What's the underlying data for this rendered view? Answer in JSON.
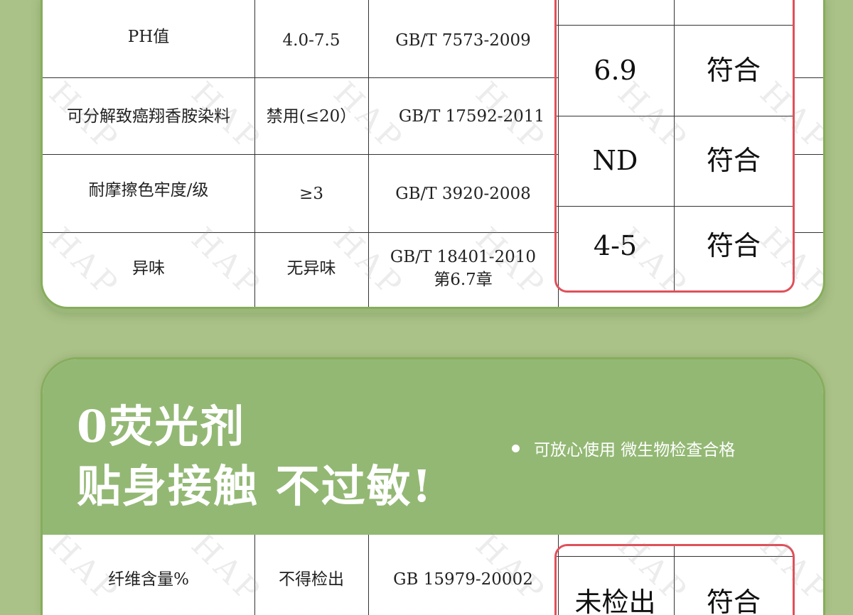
{
  "table_top": {
    "rows": [
      {
        "item": "PH值",
        "requirement": "4.0-7.5",
        "standard": "GB/T 7573-2009"
      },
      {
        "item": "可分解致癌翔香胺染料",
        "requirement": "禁用(≤20）",
        "standard": "GB/T 17592-2011"
      },
      {
        "item": "耐摩擦色牢度/级",
        "requirement": "≥3",
        "standard": "GB/T 3920-2008"
      },
      {
        "item": "异味",
        "requirement": "无异味",
        "standard": "GB/T 18401-2010",
        "standard_line2": "第6.7章"
      }
    ],
    "results": [
      {
        "value": "6.9",
        "verdict": "符合"
      },
      {
        "value": "ND",
        "verdict": "符合"
      },
      {
        "value": "4-5",
        "verdict": "符合"
      }
    ]
  },
  "section2": {
    "headline_line1": "0荧光剂",
    "headline_line2": "贴身接触 不过敏!",
    "tagline": "可放心使用 微生物检查合格"
  },
  "table_bottom": {
    "rows": [
      {
        "item": "纤维含量%",
        "requirement": "不得检出",
        "standard": "GB 15979-20002"
      }
    ],
    "results": [
      {
        "value": "未检出",
        "verdict": "符合"
      }
    ]
  },
  "watermark": "HAP",
  "colors": {
    "background": "#aac288",
    "header_green": "#93b874",
    "result_border": "#e0505a"
  }
}
